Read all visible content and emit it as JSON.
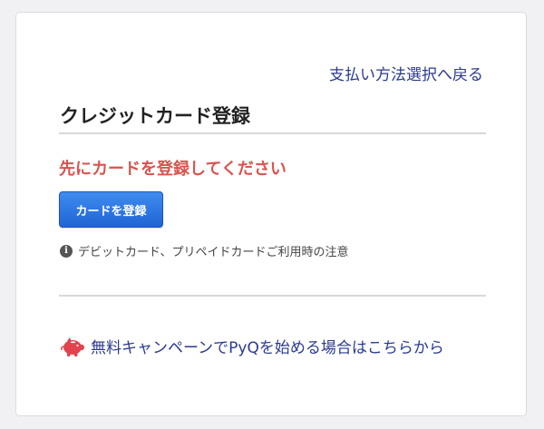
{
  "header": {
    "back_link_label": "支払い方法選択へ戻る"
  },
  "section": {
    "title": "クレジットカード登録",
    "alert": "先にカードを登録してください",
    "register_button_label": "カードを登録",
    "notice_icon": "info-icon",
    "notice_label": "デビットカード、プリペイドカードご利用時の注意"
  },
  "campaign": {
    "icon": "piggy-bank-icon",
    "label": "無料キャンペーンでPyQを始める場合はこちらから"
  },
  "colors": {
    "link": "#2b3a8f",
    "alert": "#d9534f",
    "button": "#2a74e0",
    "pig": "#e2444f"
  }
}
